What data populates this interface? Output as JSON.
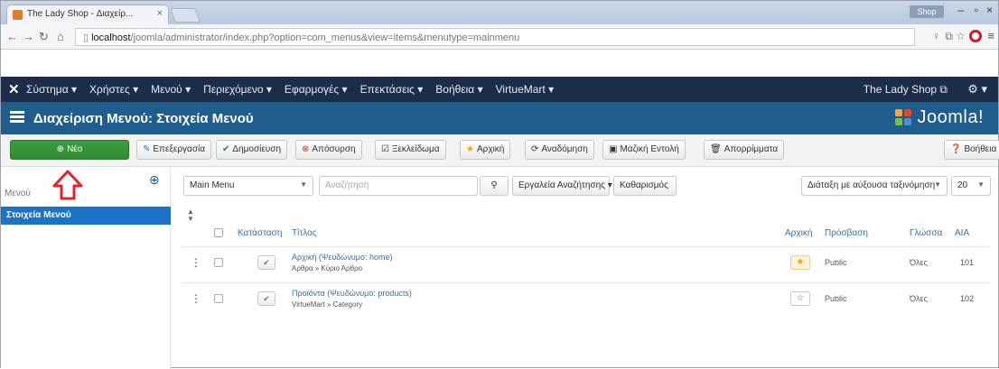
{
  "browser": {
    "tab_title": "The Lady Shop - Διαχείρ...",
    "tab_close": "×",
    "user_badge": "Shop",
    "url_host": "localhost",
    "url_path": "/joomla/administrator/index.php?option=com_menus&view=items&menutype=mainmenu",
    "minimize": "–",
    "maximize": "▫",
    "close": "×"
  },
  "topbar": {
    "menu": [
      "Σύστημα ▾",
      "Χρήστες ▾",
      "Μενού ▾",
      "Περιεχόμενο ▾",
      "Εφαρμογές ▾",
      "Επεκτάσεις ▾",
      "Βοήθεια ▾",
      "VirtueMart ▾"
    ],
    "site_link": "The Lady Shop ⧉",
    "gear": "⚙ ▾"
  },
  "titlebar": {
    "title": "Διαχείριση Μενού: Στοιχεία Μενού",
    "logo_text": "Joomla!"
  },
  "toolbar": {
    "new": "Νέο",
    "edit": "Επεξεργασία",
    "publish": "Δημοσίευση",
    "unpublish": "Απόσυρση",
    "checkin": "Ξεκλείδωμα",
    "home": "Αρχική",
    "rebuild": "Αναδόμηση",
    "batch": "Μαζική Εντολή",
    "trash": "Απορρίμματα",
    "help": "Βοήθεια"
  },
  "sidebar": {
    "label": "Μενού",
    "active_item": "Στοιχεία Μενού"
  },
  "filters": {
    "menu_select": "Main Menu",
    "search_placeholder": "Αναζήτηση",
    "search_tools": "Εργαλεία Αναζήτησης ▾",
    "clear": "Καθαρισμός",
    "ordering": "Διάταξη με αύξουσα ταξινόμηση",
    "limit": "20"
  },
  "table": {
    "headers": {
      "status": "Κατάσταση",
      "title": "Τίτλος",
      "home": "Αρχική",
      "access": "Πρόσβαση",
      "language": "Γλώσσα",
      "id": "ΑΙΑ"
    },
    "rows": [
      {
        "title": "Αρχική (Ψευδώνυμο: home)",
        "subtitle": "Άρθρα » Κύριο Άρθρο",
        "home_icon": "★",
        "access": "Public",
        "language": "Όλες",
        "id": "101"
      },
      {
        "title": "Προϊόντα (Ψευδώνυμο: products)",
        "subtitle": "VirtueMart » Category",
        "home_icon": "☆",
        "access": "Public",
        "language": "Όλες",
        "id": "102"
      }
    ]
  },
  "colors": {
    "topbar": "#1b2d49",
    "titlebar": "#1f5d8e",
    "new_button": "#379237",
    "sidebar_active": "#1a73c8",
    "arrow": "#e0242a"
  }
}
